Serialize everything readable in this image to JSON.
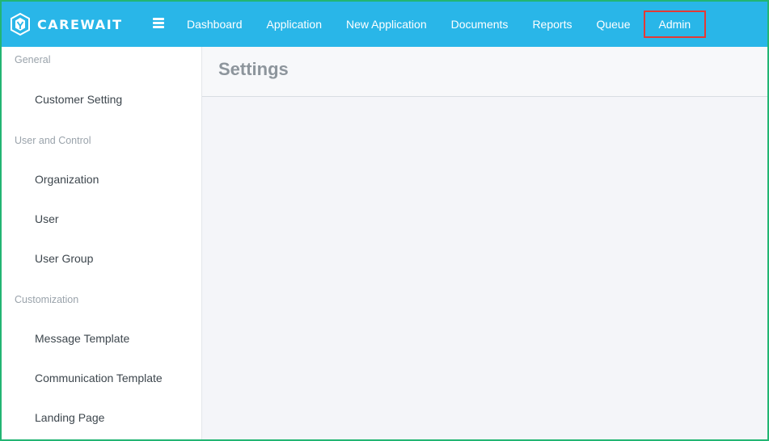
{
  "app": {
    "logo_text": "CAREWAIT"
  },
  "nav": {
    "items": [
      {
        "label": "Dashboard"
      },
      {
        "label": "Application"
      },
      {
        "label": "New Application"
      },
      {
        "label": "Documents"
      },
      {
        "label": "Reports"
      },
      {
        "label": "Queue"
      },
      {
        "label": "Admin"
      }
    ],
    "active": "Admin"
  },
  "sidebar": {
    "sections": [
      {
        "label": "General",
        "items": [
          "Customer Setting"
        ]
      },
      {
        "label": "User and Control",
        "items": [
          "Organization",
          "User",
          "User Group"
        ]
      },
      {
        "label": "Customization",
        "items": [
          "Message Template",
          "Communication Template",
          "Landing Page"
        ]
      }
    ]
  },
  "main": {
    "title": "Settings"
  },
  "colors": {
    "topbar": "#29b6e8",
    "highlight_border": "#e53935",
    "frame_border": "#22b573"
  }
}
